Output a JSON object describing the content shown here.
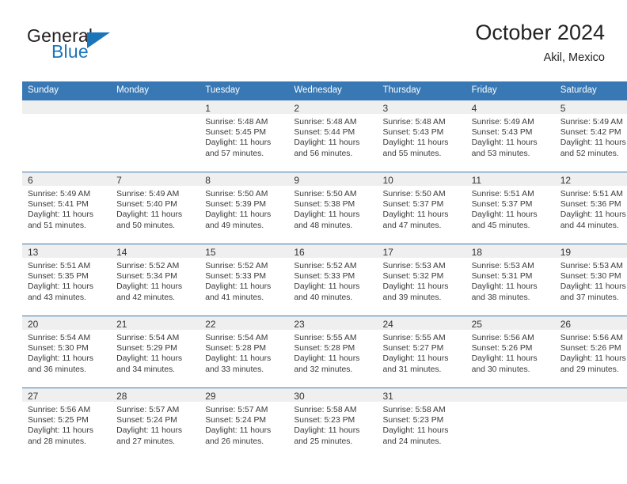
{
  "brand": {
    "name_top": "General",
    "name_bottom": "Blue",
    "accent_color": "#1b75bb"
  },
  "header": {
    "title": "October 2024",
    "subtitle": "Akil, Mexico"
  },
  "calendar": {
    "header_bg": "#3878b4",
    "daynum_bg": "#efefef",
    "weekday_headers": [
      "Sunday",
      "Monday",
      "Tuesday",
      "Wednesday",
      "Thursday",
      "Friday",
      "Saturday"
    ],
    "weeks": [
      [
        {
          "day": ""
        },
        {
          "day": ""
        },
        {
          "day": "1",
          "sunrise": "Sunrise: 5:48 AM",
          "sunset": "Sunset: 5:45 PM",
          "daylight_line1": "Daylight: 11 hours",
          "daylight_line2": "and 57 minutes."
        },
        {
          "day": "2",
          "sunrise": "Sunrise: 5:48 AM",
          "sunset": "Sunset: 5:44 PM",
          "daylight_line1": "Daylight: 11 hours",
          "daylight_line2": "and 56 minutes."
        },
        {
          "day": "3",
          "sunrise": "Sunrise: 5:48 AM",
          "sunset": "Sunset: 5:43 PM",
          "daylight_line1": "Daylight: 11 hours",
          "daylight_line2": "and 55 minutes."
        },
        {
          "day": "4",
          "sunrise": "Sunrise: 5:49 AM",
          "sunset": "Sunset: 5:43 PM",
          "daylight_line1": "Daylight: 11 hours",
          "daylight_line2": "and 53 minutes."
        },
        {
          "day": "5",
          "sunrise": "Sunrise: 5:49 AM",
          "sunset": "Sunset: 5:42 PM",
          "daylight_line1": "Daylight: 11 hours",
          "daylight_line2": "and 52 minutes."
        }
      ],
      [
        {
          "day": "6",
          "sunrise": "Sunrise: 5:49 AM",
          "sunset": "Sunset: 5:41 PM",
          "daylight_line1": "Daylight: 11 hours",
          "daylight_line2": "and 51 minutes."
        },
        {
          "day": "7",
          "sunrise": "Sunrise: 5:49 AM",
          "sunset": "Sunset: 5:40 PM",
          "daylight_line1": "Daylight: 11 hours",
          "daylight_line2": "and 50 minutes."
        },
        {
          "day": "8",
          "sunrise": "Sunrise: 5:50 AM",
          "sunset": "Sunset: 5:39 PM",
          "daylight_line1": "Daylight: 11 hours",
          "daylight_line2": "and 49 minutes."
        },
        {
          "day": "9",
          "sunrise": "Sunrise: 5:50 AM",
          "sunset": "Sunset: 5:38 PM",
          "daylight_line1": "Daylight: 11 hours",
          "daylight_line2": "and 48 minutes."
        },
        {
          "day": "10",
          "sunrise": "Sunrise: 5:50 AM",
          "sunset": "Sunset: 5:37 PM",
          "daylight_line1": "Daylight: 11 hours",
          "daylight_line2": "and 47 minutes."
        },
        {
          "day": "11",
          "sunrise": "Sunrise: 5:51 AM",
          "sunset": "Sunset: 5:37 PM",
          "daylight_line1": "Daylight: 11 hours",
          "daylight_line2": "and 45 minutes."
        },
        {
          "day": "12",
          "sunrise": "Sunrise: 5:51 AM",
          "sunset": "Sunset: 5:36 PM",
          "daylight_line1": "Daylight: 11 hours",
          "daylight_line2": "and 44 minutes."
        }
      ],
      [
        {
          "day": "13",
          "sunrise": "Sunrise: 5:51 AM",
          "sunset": "Sunset: 5:35 PM",
          "daylight_line1": "Daylight: 11 hours",
          "daylight_line2": "and 43 minutes."
        },
        {
          "day": "14",
          "sunrise": "Sunrise: 5:52 AM",
          "sunset": "Sunset: 5:34 PM",
          "daylight_line1": "Daylight: 11 hours",
          "daylight_line2": "and 42 minutes."
        },
        {
          "day": "15",
          "sunrise": "Sunrise: 5:52 AM",
          "sunset": "Sunset: 5:33 PM",
          "daylight_line1": "Daylight: 11 hours",
          "daylight_line2": "and 41 minutes."
        },
        {
          "day": "16",
          "sunrise": "Sunrise: 5:52 AM",
          "sunset": "Sunset: 5:33 PM",
          "daylight_line1": "Daylight: 11 hours",
          "daylight_line2": "and 40 minutes."
        },
        {
          "day": "17",
          "sunrise": "Sunrise: 5:53 AM",
          "sunset": "Sunset: 5:32 PM",
          "daylight_line1": "Daylight: 11 hours",
          "daylight_line2": "and 39 minutes."
        },
        {
          "day": "18",
          "sunrise": "Sunrise: 5:53 AM",
          "sunset": "Sunset: 5:31 PM",
          "daylight_line1": "Daylight: 11 hours",
          "daylight_line2": "and 38 minutes."
        },
        {
          "day": "19",
          "sunrise": "Sunrise: 5:53 AM",
          "sunset": "Sunset: 5:30 PM",
          "daylight_line1": "Daylight: 11 hours",
          "daylight_line2": "and 37 minutes."
        }
      ],
      [
        {
          "day": "20",
          "sunrise": "Sunrise: 5:54 AM",
          "sunset": "Sunset: 5:30 PM",
          "daylight_line1": "Daylight: 11 hours",
          "daylight_line2": "and 36 minutes."
        },
        {
          "day": "21",
          "sunrise": "Sunrise: 5:54 AM",
          "sunset": "Sunset: 5:29 PM",
          "daylight_line1": "Daylight: 11 hours",
          "daylight_line2": "and 34 minutes."
        },
        {
          "day": "22",
          "sunrise": "Sunrise: 5:54 AM",
          "sunset": "Sunset: 5:28 PM",
          "daylight_line1": "Daylight: 11 hours",
          "daylight_line2": "and 33 minutes."
        },
        {
          "day": "23",
          "sunrise": "Sunrise: 5:55 AM",
          "sunset": "Sunset: 5:28 PM",
          "daylight_line1": "Daylight: 11 hours",
          "daylight_line2": "and 32 minutes."
        },
        {
          "day": "24",
          "sunrise": "Sunrise: 5:55 AM",
          "sunset": "Sunset: 5:27 PM",
          "daylight_line1": "Daylight: 11 hours",
          "daylight_line2": "and 31 minutes."
        },
        {
          "day": "25",
          "sunrise": "Sunrise: 5:56 AM",
          "sunset": "Sunset: 5:26 PM",
          "daylight_line1": "Daylight: 11 hours",
          "daylight_line2": "and 30 minutes."
        },
        {
          "day": "26",
          "sunrise": "Sunrise: 5:56 AM",
          "sunset": "Sunset: 5:26 PM",
          "daylight_line1": "Daylight: 11 hours",
          "daylight_line2": "and 29 minutes."
        }
      ],
      [
        {
          "day": "27",
          "sunrise": "Sunrise: 5:56 AM",
          "sunset": "Sunset: 5:25 PM",
          "daylight_line1": "Daylight: 11 hours",
          "daylight_line2": "and 28 minutes."
        },
        {
          "day": "28",
          "sunrise": "Sunrise: 5:57 AM",
          "sunset": "Sunset: 5:24 PM",
          "daylight_line1": "Daylight: 11 hours",
          "daylight_line2": "and 27 minutes."
        },
        {
          "day": "29",
          "sunrise": "Sunrise: 5:57 AM",
          "sunset": "Sunset: 5:24 PM",
          "daylight_line1": "Daylight: 11 hours",
          "daylight_line2": "and 26 minutes."
        },
        {
          "day": "30",
          "sunrise": "Sunrise: 5:58 AM",
          "sunset": "Sunset: 5:23 PM",
          "daylight_line1": "Daylight: 11 hours",
          "daylight_line2": "and 25 minutes."
        },
        {
          "day": "31",
          "sunrise": "Sunrise: 5:58 AM",
          "sunset": "Sunset: 5:23 PM",
          "daylight_line1": "Daylight: 11 hours",
          "daylight_line2": "and 24 minutes."
        },
        {
          "day": ""
        },
        {
          "day": ""
        }
      ]
    ]
  }
}
